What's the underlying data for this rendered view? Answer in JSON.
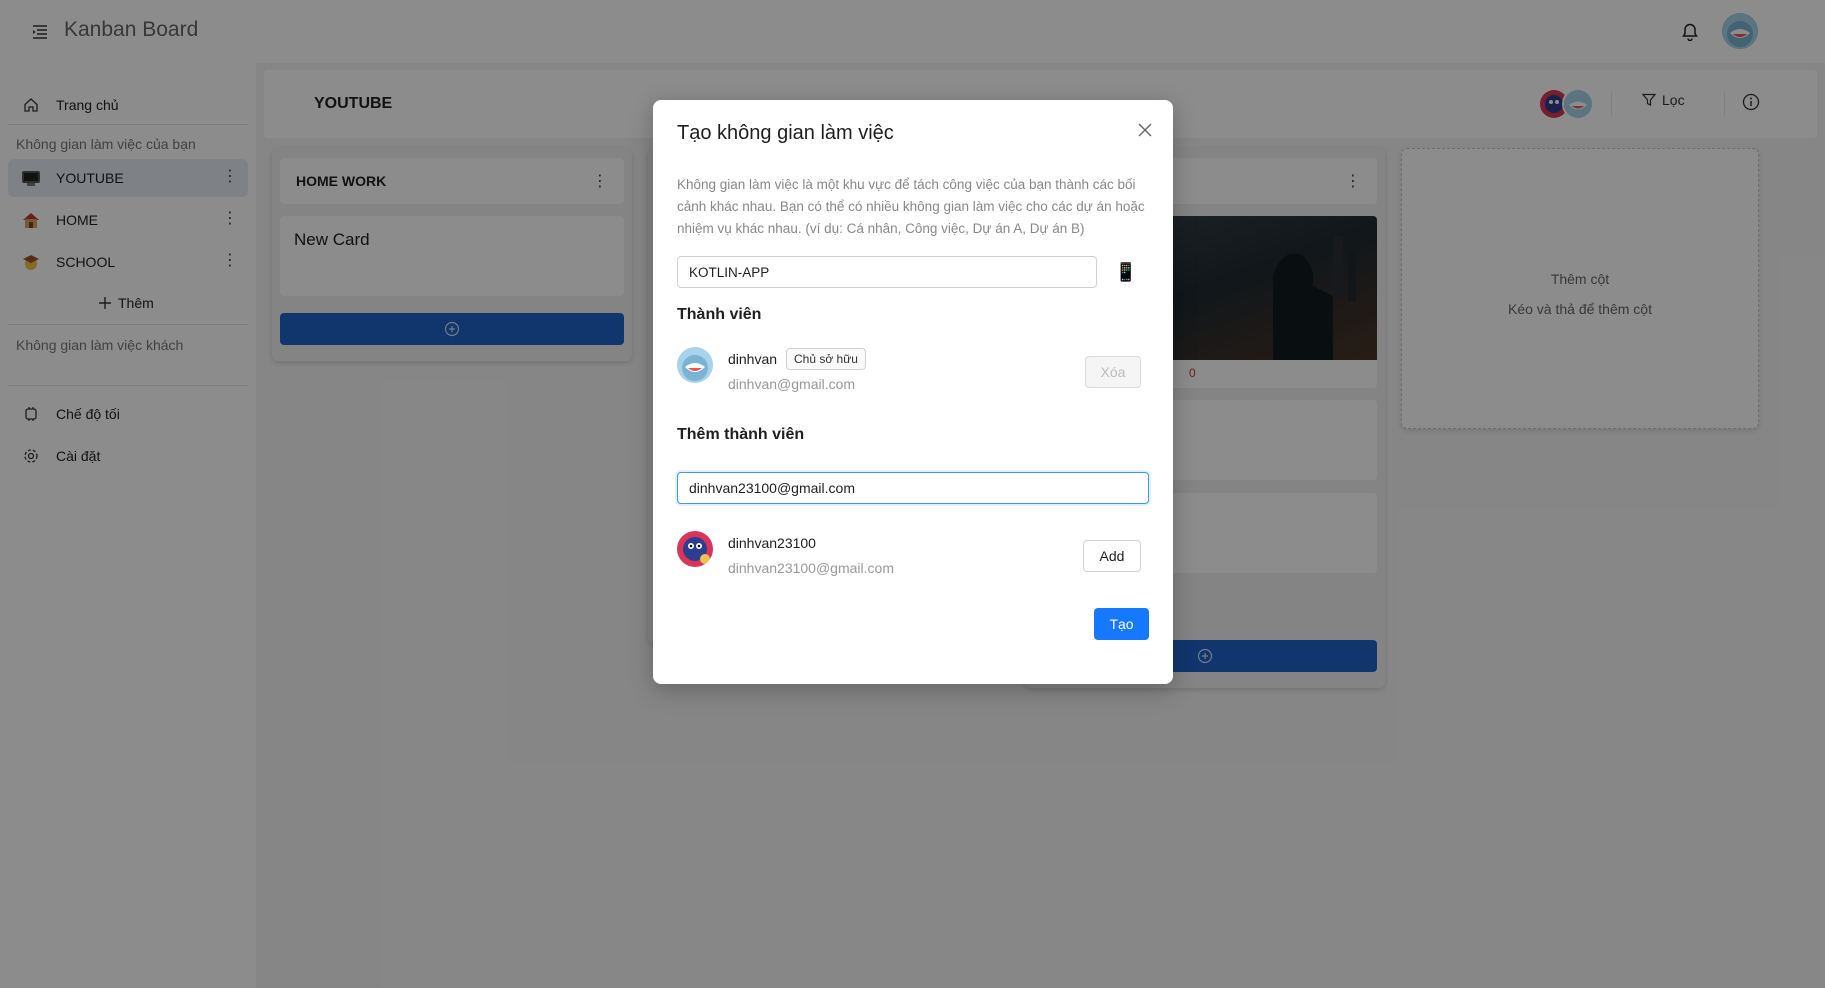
{
  "app": {
    "title": "Kanban Board"
  },
  "sidebar": {
    "home_label": "Trang chủ",
    "my_workspaces_label": "Không gian làm việc của bạn",
    "workspaces": [
      {
        "label": "YOUTUBE",
        "icon": "tv-emoji-icon",
        "active": true
      },
      {
        "label": "HOME",
        "icon": "house-emoji-icon",
        "active": false
      },
      {
        "label": "SCHOOL",
        "icon": "school-emoji-icon",
        "active": false
      }
    ],
    "add_label": "Thêm",
    "guest_workspaces_label": "Không gian làm việc khách",
    "dark_mode_label": "Chế độ tối",
    "settings_label": "Cài đặt"
  },
  "board": {
    "title": "YOUTUBE",
    "filter_label": "Lọc",
    "columns": [
      {
        "title": "HOME WORK",
        "cards": [
          {
            "title": "New Card"
          }
        ]
      }
    ],
    "third_column_fragment": "0",
    "add_column": {
      "title": "Thêm cột",
      "hint": "Kéo và thả để thêm cột"
    }
  },
  "modal": {
    "title": "Tạo không gian làm việc",
    "description": "Không gian làm việc là một khu vực để tách công việc của bạn thành các bối cảnh khác nhau. Bạn có thể có nhiều không gian làm việc cho các dự án hoặc nhiệm vụ khác nhau. (ví dụ: Cá nhân, Công việc, Dự án A, Dự án B)",
    "workspace_name_value": "KOTLIN-APP",
    "workspace_emoji": "📱",
    "members_title": "Thành viên",
    "members": [
      {
        "name": "dinhvan",
        "email": "dinhvan@gmail.com",
        "role_tag": "Chủ sở hữu",
        "remove_label": "Xóa"
      }
    ],
    "add_member_title": "Thêm thành viên",
    "search_email_value": "dinhvan23100@gmail.com",
    "search_results": [
      {
        "name": "dinhvan23100",
        "email": "dinhvan23100@gmail.com",
        "add_label": "Add"
      }
    ],
    "create_label": "Tạo"
  },
  "colors": {
    "primary": "#1677ff",
    "column_button": "#1f63c6",
    "overlay": "rgba(0,0,0,0.45)",
    "active_sidebar": "#e6ecf5"
  }
}
